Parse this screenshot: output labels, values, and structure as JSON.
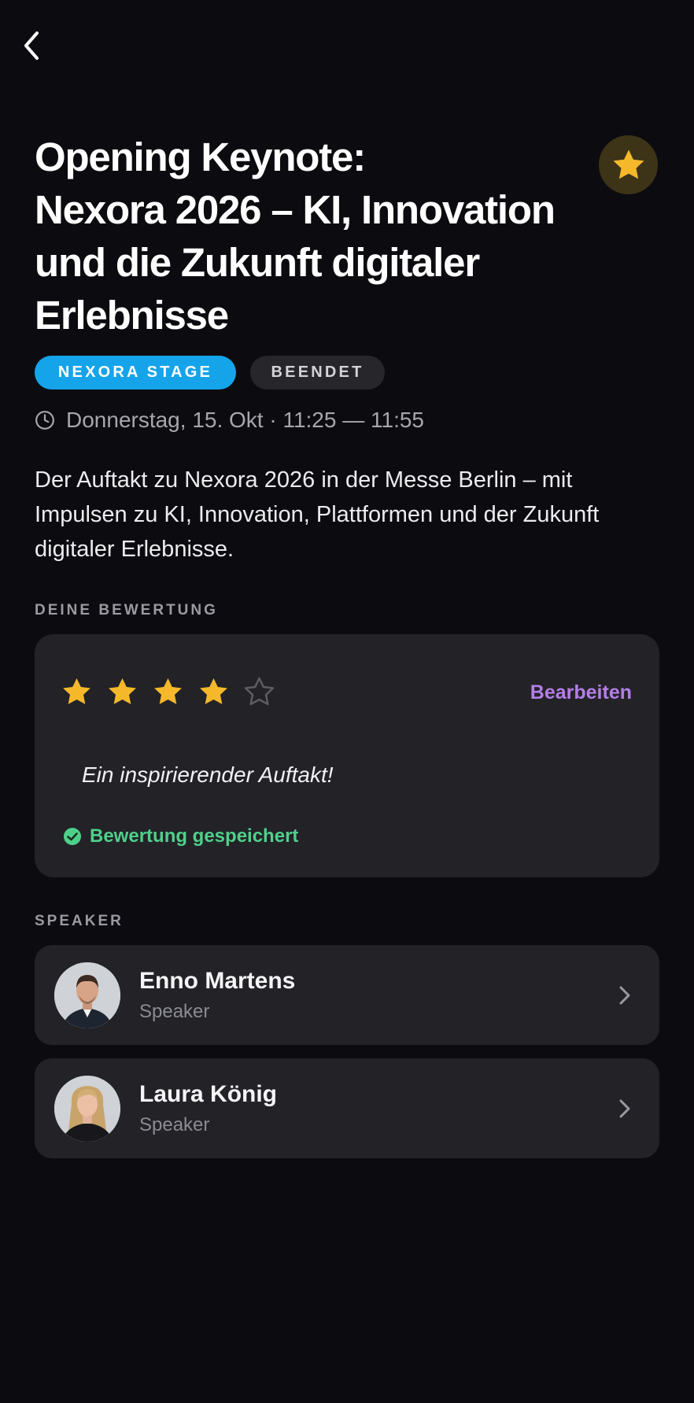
{
  "nav": {
    "back_icon": "chevron-left-icon"
  },
  "favorite": {
    "icon": "star-icon",
    "active": true,
    "color": "#f5b82a"
  },
  "session": {
    "title_lines": [
      "Opening Keynote:",
      "Nexora 2026 – KI, Innovation",
      "und die Zukunft digitaler",
      "Erlebnisse"
    ],
    "stage": "NEXORA STAGE",
    "status": "BEENDET",
    "datetime": "Donnerstag, 15. Okt · 11:25 — 11:55",
    "description": "Der Auftakt zu Nexora 2026 in der Messe Berlin – mit Impulsen zu KI, Innovation, Plattformen und der Zukunft digitaler Erlebnisse."
  },
  "rating": {
    "section_label": "DEINE BEWERTUNG",
    "stars": 4,
    "max_stars": 5,
    "edit_label": "Bearbeiten",
    "comment": "Ein inspirierender Auftakt!",
    "saved_label": "Bewertung gespeichert"
  },
  "speakers": {
    "section_label": "SPEAKER",
    "items": [
      {
        "name": "Enno Martens",
        "role": "Speaker"
      },
      {
        "name": "Laura König",
        "role": "Speaker"
      }
    ]
  },
  "colors": {
    "background": "#0c0c10",
    "card": "#222227",
    "accent_blue": "#15a4ea",
    "accent_purple": "#b57ee6",
    "star": "#f5b82a",
    "success": "#4fd08a"
  }
}
